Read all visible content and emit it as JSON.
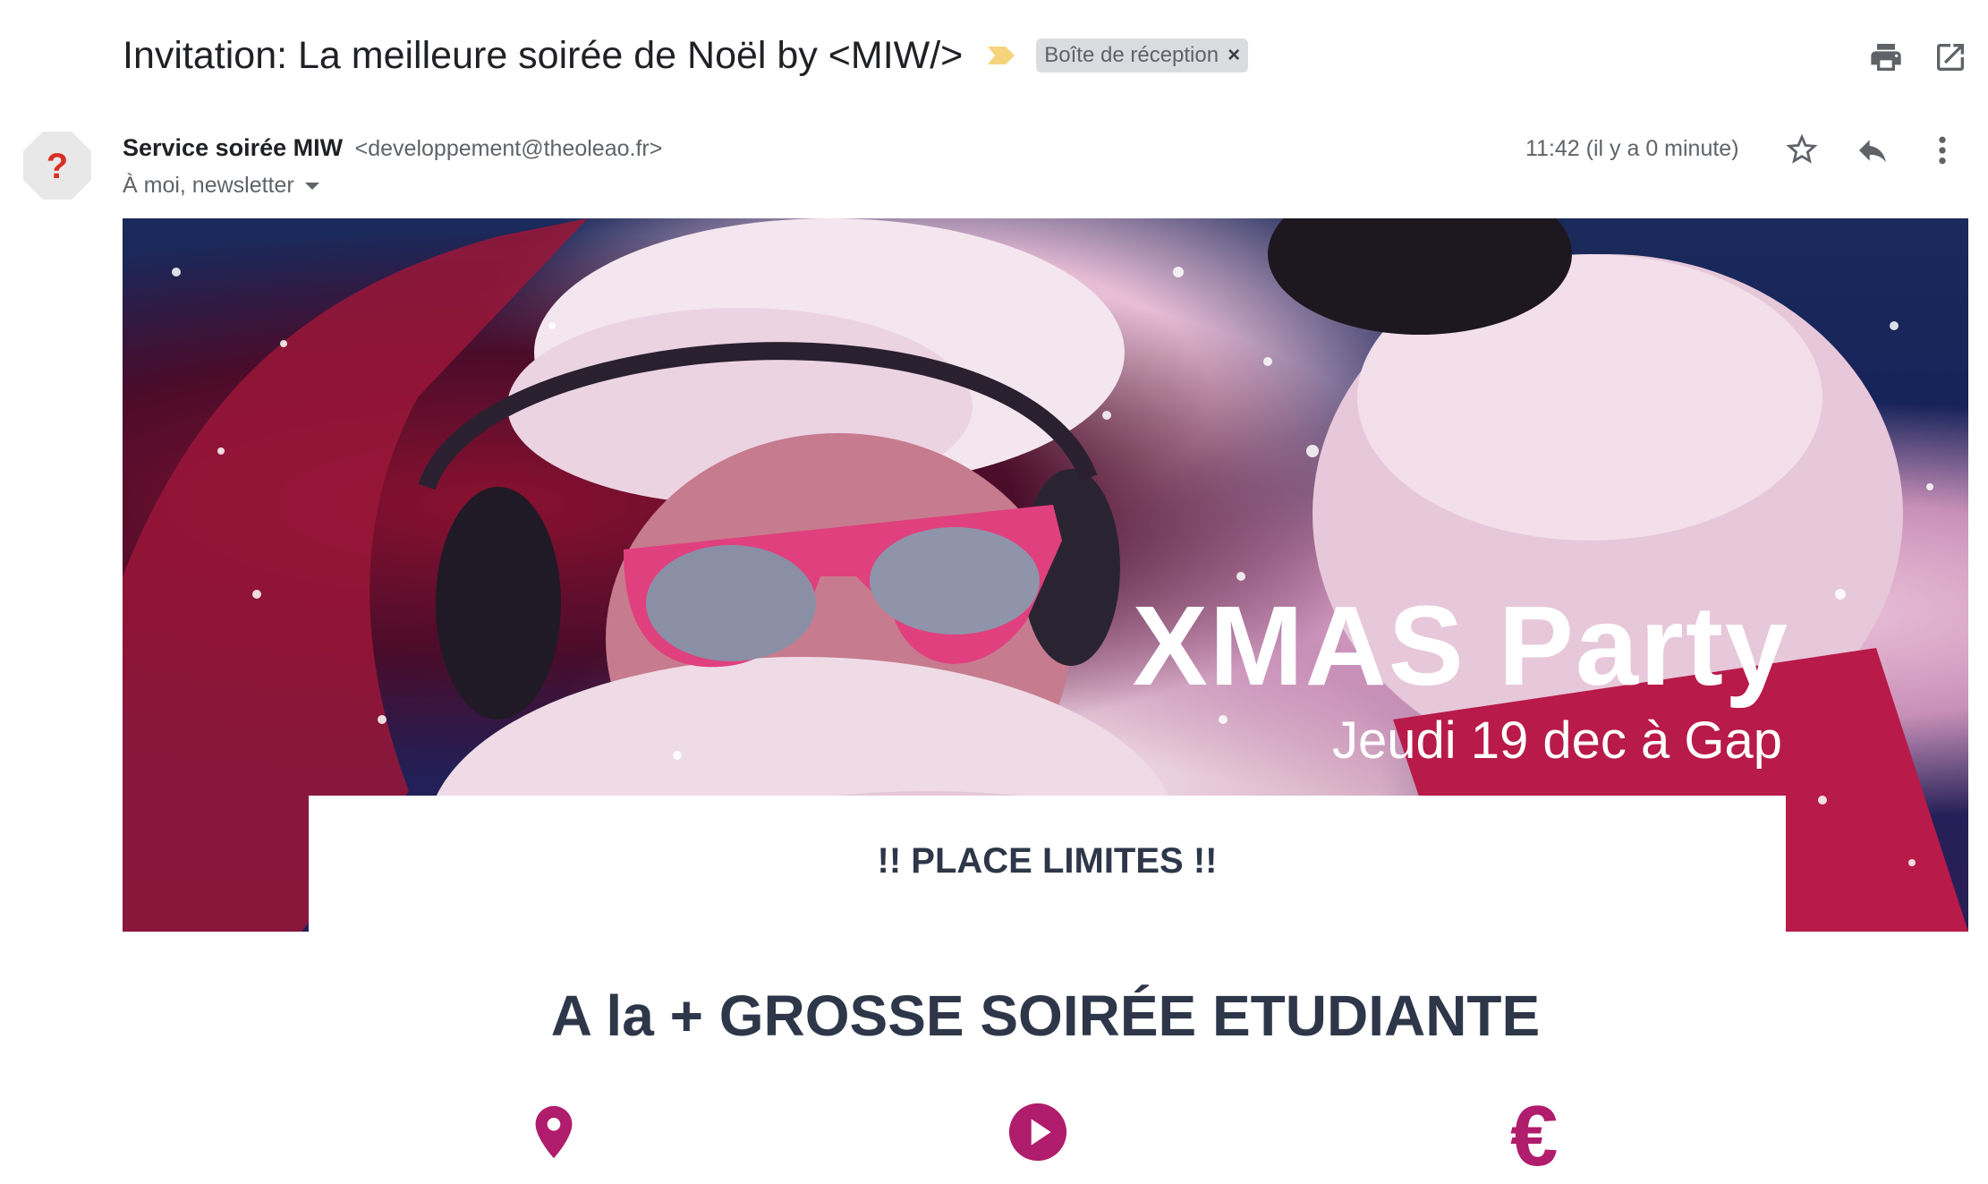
{
  "email": {
    "subject": "Invitation: La meilleure soirée de Noël by <MIW/>",
    "label": "Boîte de réception",
    "label_remove": "×",
    "sender_name": "Service soirée MIW",
    "sender_email": "<developpement@theoleao.fr>",
    "recipients": "À moi, newsletter",
    "timestamp": "11:42 (il y a 0 minute)",
    "avatar_glyph": "?"
  },
  "icons": {
    "importance": "importance-marker-icon",
    "print": "print-icon",
    "open_new_window": "open-in-new-icon",
    "star": "star-icon",
    "reply": "reply-icon",
    "more": "more-vert-icon",
    "location": "map-pin-icon",
    "play": "play-icon",
    "euro": "euro-icon"
  },
  "newsletter": {
    "title": "XMAS Party",
    "subtitle": "Jeudi 19 dec à Gap",
    "places": "!! PLACE LIMITES !!",
    "headline": "A la + GROSSE SOIRÉE ETUDIANTE",
    "euro_symbol": "€"
  },
  "colors": {
    "accent": "#b01d6c",
    "heading": "#2e3749",
    "chip_bg": "#dadce0",
    "importance": "#f4d47c"
  }
}
